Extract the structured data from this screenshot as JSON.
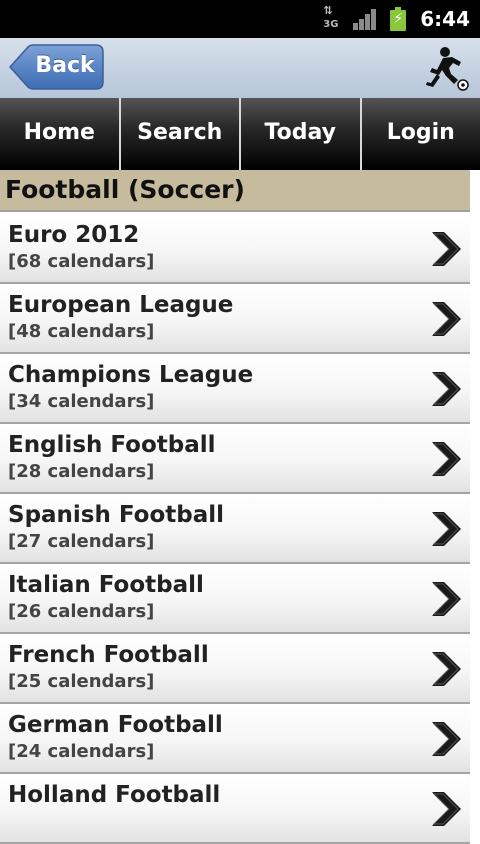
{
  "status_bar": {
    "network_arrows": "⇅",
    "network_label": "3G",
    "signal_icon": "signal-bars-icon",
    "battery_icon": "battery-charging-icon",
    "time": "6:44"
  },
  "titlebar": {
    "back_label": "Back",
    "logo_icon": "soccer-player-icon"
  },
  "nav": {
    "tabs": [
      {
        "label": "Home"
      },
      {
        "label": "Search"
      },
      {
        "label": "Today"
      },
      {
        "label": "Login"
      }
    ]
  },
  "section": {
    "title": "Football (Soccer)"
  },
  "list": {
    "chevron_icon": "chevron-right-icon",
    "items": [
      {
        "title": "Euro 2012",
        "subtitle": "[68 calendars]"
      },
      {
        "title": "European League",
        "subtitle": "[48 calendars]"
      },
      {
        "title": "Champions League",
        "subtitle": "[34 calendars]"
      },
      {
        "title": "English Football",
        "subtitle": "[28 calendars]"
      },
      {
        "title": "Spanish Football",
        "subtitle": "[27 calendars]"
      },
      {
        "title": "Italian Football",
        "subtitle": "[26 calendars]"
      },
      {
        "title": "French Football",
        "subtitle": "[25 calendars]"
      },
      {
        "title": "German Football",
        "subtitle": "[24 calendars]"
      },
      {
        "title": "Holland Football",
        "subtitle": ""
      }
    ]
  },
  "colors": {
    "titlebar_bg": "#c4d1e0",
    "back_button": "#5b87c7",
    "nav_bg": "#000000",
    "section_bg": "#c7bb9e",
    "battery": "#8ac63b"
  }
}
